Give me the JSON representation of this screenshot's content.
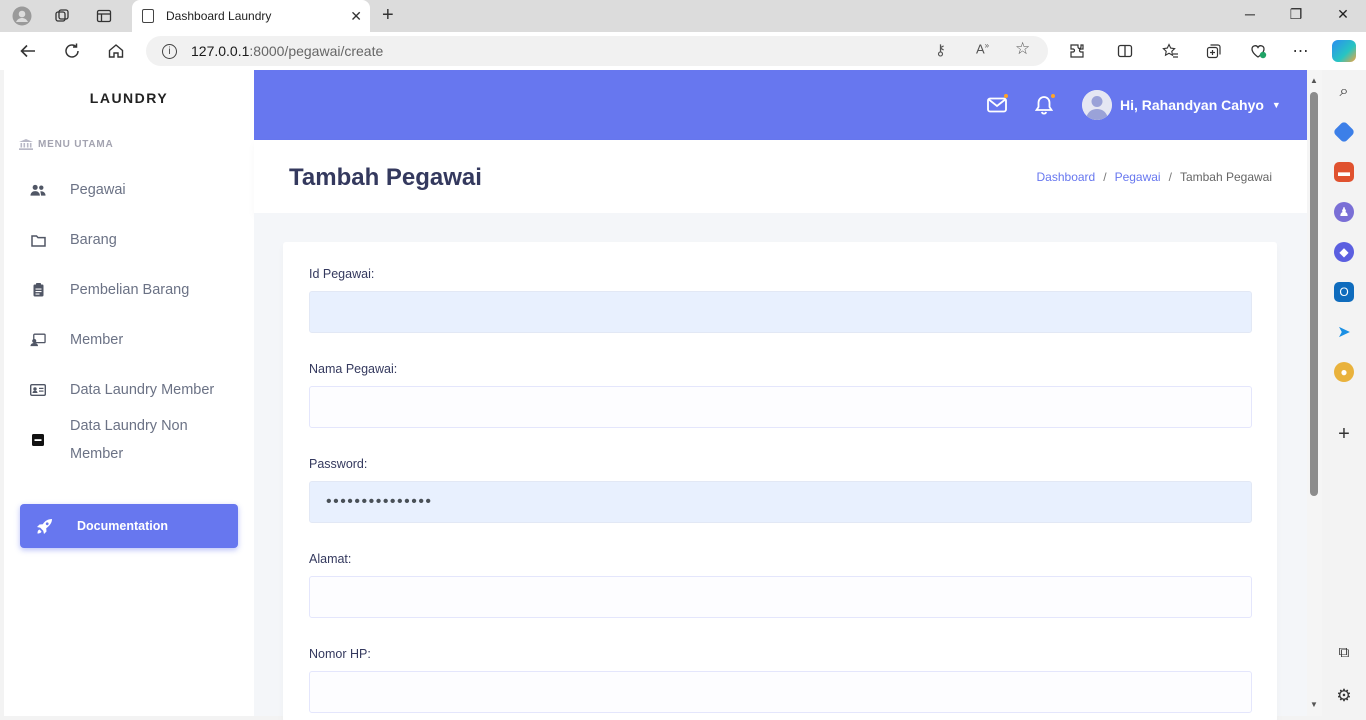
{
  "browser": {
    "tab_title": "Dashboard Laundry",
    "url_host": "127.0.0.1",
    "url_path": ":8000/pegawai/create"
  },
  "sidebar": {
    "brand": "LAUNDRY",
    "menu_header": "MENU UTAMA",
    "items": [
      {
        "label": "Pegawai",
        "icon": "users-icon"
      },
      {
        "label": "Barang",
        "icon": "folder-icon"
      },
      {
        "label": "Pembelian Barang",
        "icon": "clipboard-icon"
      },
      {
        "label": "Member",
        "icon": "user-card-icon"
      },
      {
        "label": "Data Laundry Member",
        "icon": "id-card-icon"
      },
      {
        "label": "Data Laundry Non Member",
        "icon": "minus-square-icon"
      }
    ],
    "doc_button": "Documentation"
  },
  "topnav": {
    "user_greeting": "Hi, Rahandyan Cahyo"
  },
  "header": {
    "title": "Tambah Pegawai",
    "breadcrumb": [
      "Dashboard",
      "Pegawai",
      "Tambah Pegawai"
    ]
  },
  "form": {
    "fields": [
      {
        "label": "Id Pegawai:",
        "value": ""
      },
      {
        "label": "Nama Pegawai:",
        "value": ""
      },
      {
        "label": "Password:",
        "value": "•••••••••••••••"
      },
      {
        "label": "Alamat:",
        "value": ""
      },
      {
        "label": "Nomor HP:",
        "value": ""
      }
    ]
  },
  "colors": {
    "primary": "#6777ef",
    "title": "#34395e",
    "autofill": "#e8f0fe"
  }
}
